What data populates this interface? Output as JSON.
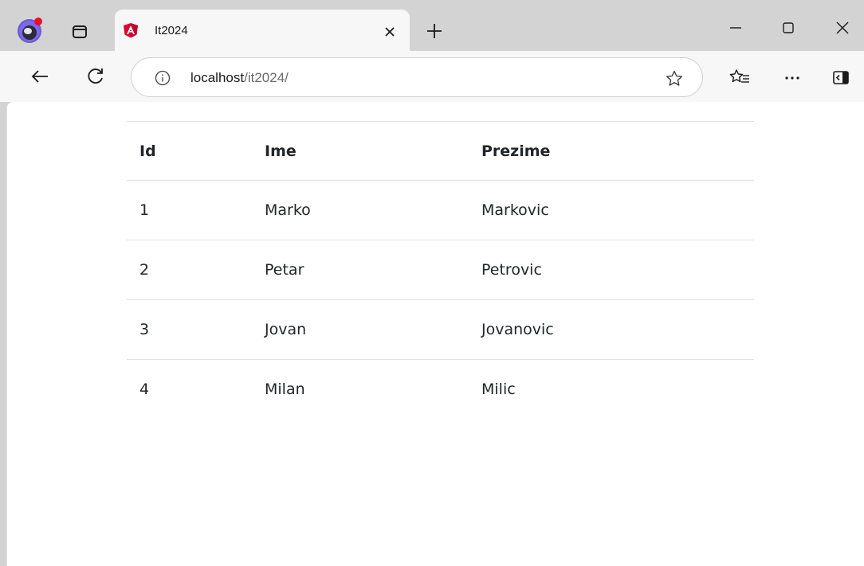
{
  "browser": {
    "tab": {
      "title": "It2024"
    },
    "address_bar": {
      "host": "localhost",
      "path": "/it2024/"
    }
  },
  "table": {
    "headers": [
      "Id",
      "Ime",
      "Prezime"
    ],
    "rows": [
      [
        "1",
        "Marko",
        "Markovic"
      ],
      [
        "2",
        "Petar",
        "Petrovic"
      ],
      [
        "3",
        "Jovan",
        "Jovanovic"
      ],
      [
        "4",
        "Milan",
        "Milic"
      ]
    ]
  },
  "icons": {
    "profile": "profile-avatar-icon",
    "tab_actions": "tab-actions-icon",
    "favicon": "angular-logo-icon",
    "tab_close": "close-icon",
    "new_tab": "plus-icon",
    "minimize": "minimize-icon",
    "maximize": "maximize-icon",
    "window_close": "close-icon",
    "back": "arrow-left-icon",
    "refresh": "refresh-icon",
    "site_info": "info-icon",
    "favorite": "star-icon",
    "favorites_list": "favorites-icon",
    "more": "more-icon",
    "sidebar": "sidebar-icon"
  },
  "colors": {
    "chrome": "#d3d3d3",
    "toolbar": "#f7f7f7",
    "text": "#212529",
    "row_border": "#dee2e6",
    "angular_red": "#dd0031",
    "angular_magenta": "#c3002f"
  }
}
